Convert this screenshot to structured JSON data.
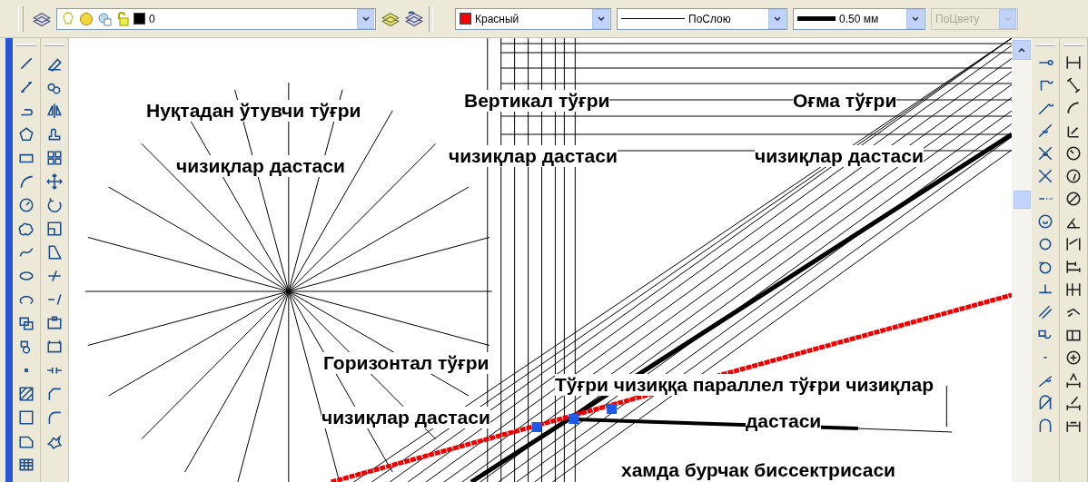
{
  "toolbar": {
    "layer": {
      "value": "0"
    },
    "color": {
      "value": "Красный"
    },
    "linetype": {
      "value": "ПоСлою"
    },
    "lineweight": {
      "value": "0.50 мм"
    },
    "plot_style": {
      "value": "ПоЦвету",
      "disabled": true
    }
  },
  "canvas": {
    "labels": [
      {
        "text": "Нуқтадан ўтувчи тўғри"
      },
      {
        "text": "чизиқлар дастаси"
      },
      {
        "text": "Вертикал тўғри"
      },
      {
        "text": "чизиқлар дастаси"
      },
      {
        "text": "Оғма тўғри"
      },
      {
        "text": "чизиқлар дастаси"
      },
      {
        "text": "Горизонтал тўғри"
      },
      {
        "text": "чизиқлар дастаси"
      },
      {
        "text": "Тўғри чизиққа параллел тўғри чизиқлар"
      },
      {
        "text": "дастаси"
      },
      {
        "text": "хамда бурчак биссектрисаси"
      }
    ]
  }
}
